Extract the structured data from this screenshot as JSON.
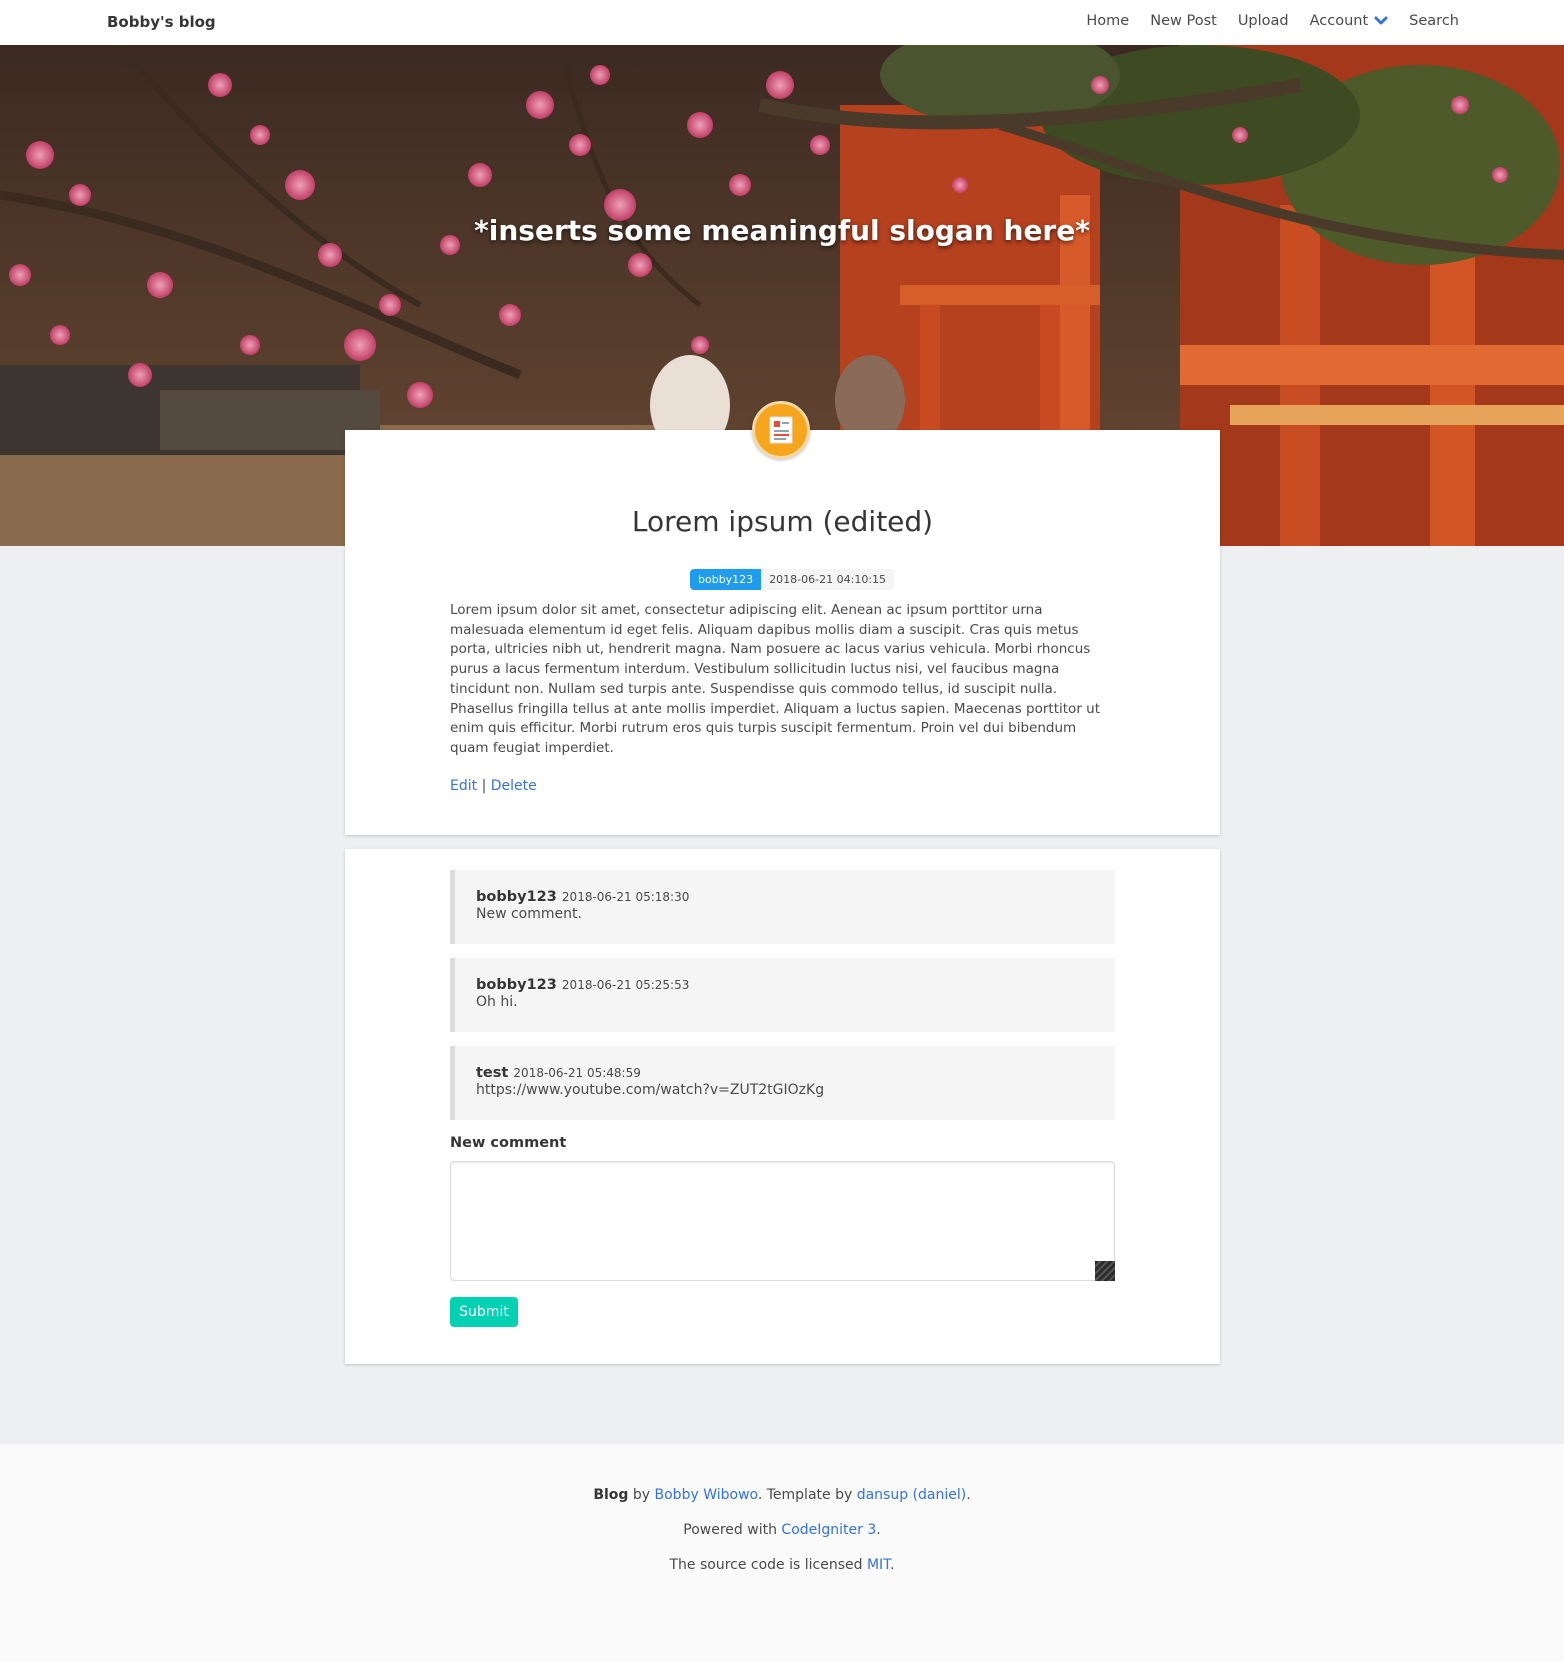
{
  "navbar": {
    "brand": "Bobby's blog",
    "items": [
      {
        "label": "Home"
      },
      {
        "label": "New Post"
      },
      {
        "label": "Upload"
      },
      {
        "label": "Account"
      },
      {
        "label": "Search"
      }
    ]
  },
  "hero": {
    "slogan": "*inserts some meaningful slogan here*"
  },
  "post": {
    "title": "Lorem ipsum (edited)",
    "author": "bobby123",
    "date": "2018-06-21 04:10:15",
    "body": "Lorem ipsum dolor sit amet, consectetur adipiscing elit. Aenean ac ipsum porttitor urna malesuada elementum id eget felis. Aliquam dapibus mollis diam a suscipit. Cras quis metus porta, ultricies nibh ut, hendrerit magna. Nam posuere ac lacus varius vehicula. Morbi rhoncus purus a lacus fermentum interdum. Vestibulum sollicitudin luctus nisi, vel faucibus magna tincidunt non. Nullam sed turpis ante. Suspendisse quis commodo tellus, id suscipit nulla. Phasellus fringilla tellus at ante mollis imperdiet. Aliquam a luctus sapien. Maecenas porttitor ut enim quis efficitur. Morbi rutrum eros quis turpis suscipit fermentum. Proin vel dui bibendum quam feugiat imperdiet.",
    "edit_label": "Edit",
    "separator": "|",
    "delete_label": "Delete"
  },
  "comments": [
    {
      "author": "bobby123",
      "date": "2018-06-21 05:18:30",
      "text": "New comment."
    },
    {
      "author": "bobby123",
      "date": "2018-06-21 05:25:53",
      "text": "Oh hi."
    },
    {
      "author": "test",
      "date": "2018-06-21 05:48:59",
      "text": "https://www.youtube.com/watch?v=ZUT2tGIOzKg"
    }
  ],
  "comment_form": {
    "label": "New comment",
    "value": "",
    "submit_label": "Submit"
  },
  "footer": {
    "line1": {
      "bold": "Blog",
      "by": "by",
      "author": "Bobby Wibowo",
      "mid": ". Template by",
      "template": "dansup (daniel)",
      "end": "."
    },
    "line2": {
      "pre": "Powered with",
      "link": "CodeIgniter 3",
      "end": "."
    },
    "line3": {
      "pre": "The source code is licensed",
      "link": "MIT",
      "end": "."
    }
  },
  "colors": {
    "accent_link": "#3273dc",
    "tag_author": "#209cee",
    "submit": "#00d1b2",
    "chevron": "#3273dc",
    "avatar": "#f6a61c"
  }
}
